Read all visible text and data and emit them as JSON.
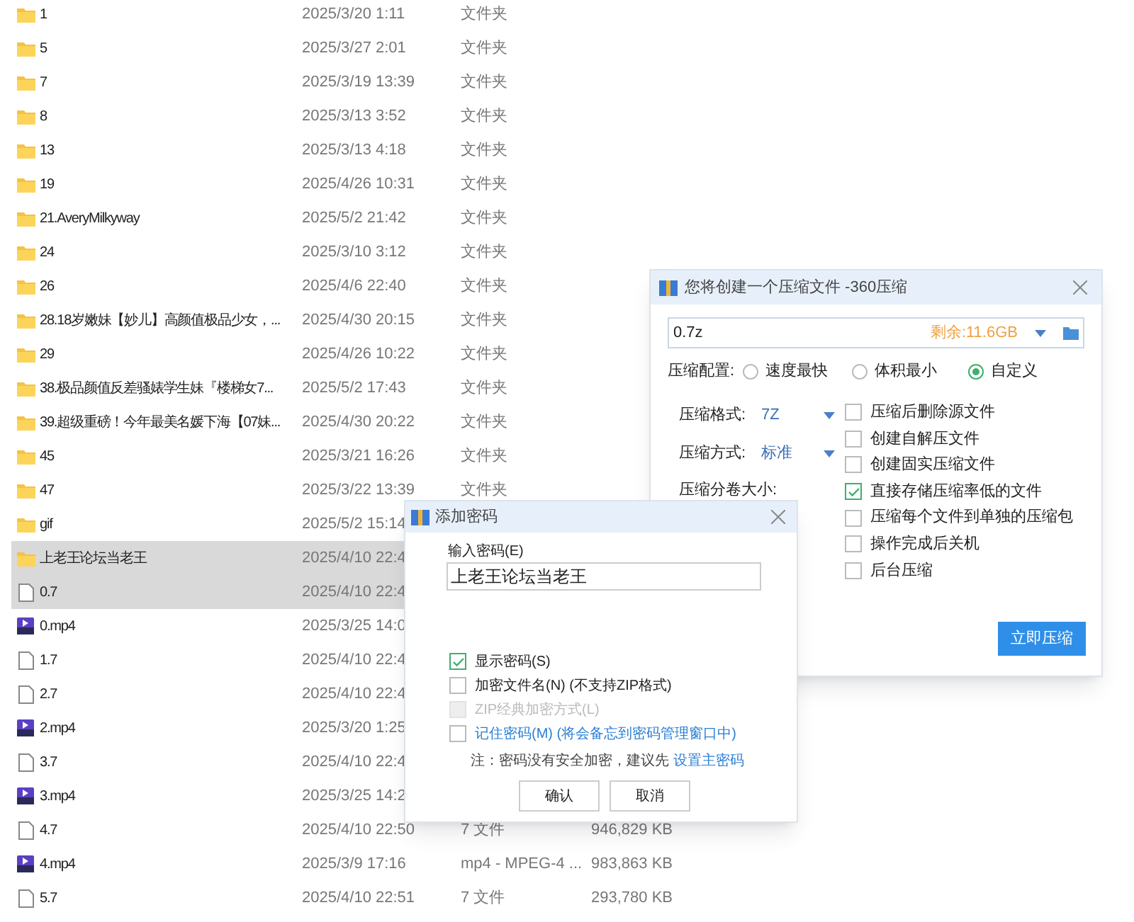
{
  "files": [
    {
      "kind": "folder",
      "name": "1",
      "date": "2025/3/20 1:11",
      "type": "文件夹",
      "selected": false
    },
    {
      "kind": "folder",
      "name": "5",
      "date": "2025/3/27 2:01",
      "type": "文件夹",
      "selected": false
    },
    {
      "kind": "folder",
      "name": "7",
      "date": "2025/3/19 13:39",
      "type": "文件夹",
      "selected": false
    },
    {
      "kind": "folder",
      "name": "8",
      "date": "2025/3/13 3:52",
      "type": "文件夹",
      "selected": false
    },
    {
      "kind": "folder",
      "name": "13",
      "date": "2025/3/13 4:18",
      "type": "文件夹",
      "selected": false
    },
    {
      "kind": "folder",
      "name": "19",
      "date": "2025/4/26 10:31",
      "type": "文件夹",
      "selected": false
    },
    {
      "kind": "folder",
      "name": "21.AveryMilkyway",
      "date": "2025/5/2 21:42",
      "type": "文件夹",
      "selected": false
    },
    {
      "kind": "folder",
      "name": "24",
      "date": "2025/3/10 3:12",
      "type": "文件夹",
      "selected": false
    },
    {
      "kind": "folder",
      "name": "26",
      "date": "2025/4/6 22:40",
      "type": "文件夹",
      "selected": false
    },
    {
      "kind": "folder",
      "name": "28.18岁嫩妹【妙儿】高颜值极品少女，...",
      "date": "2025/4/30 20:15",
      "type": "文件夹",
      "selected": false
    },
    {
      "kind": "folder",
      "name": "29",
      "date": "2025/4/26 10:22",
      "type": "文件夹",
      "selected": false
    },
    {
      "kind": "folder",
      "name": "38.极品颜值反差骚婊学生妹『楼梯女7...",
      "date": "2025/5/2 17:43",
      "type": "文件夹",
      "selected": false
    },
    {
      "kind": "folder",
      "name": "39.超级重磅！今年最美名媛下海【07妹...",
      "date": "2025/4/30 20:22",
      "type": "文件夹",
      "selected": false
    },
    {
      "kind": "folder",
      "name": "45",
      "date": "2025/3/21 16:26",
      "type": "文件夹",
      "selected": false
    },
    {
      "kind": "folder",
      "name": "47",
      "date": "2025/3/22 13:39",
      "type": "文件夹",
      "selected": false
    },
    {
      "kind": "folder",
      "name": "gif",
      "date": "2025/5/2 15:14",
      "selected": false
    },
    {
      "kind": "folder",
      "name": "上老王论坛当老王",
      "date": "2025/4/10 22:4",
      "selected": true
    },
    {
      "kind": "file",
      "name": "0.7",
      "date": "2025/4/10 22:4",
      "selected": true
    },
    {
      "kind": "video",
      "name": "0.mp4",
      "date": "2025/3/25 14:0",
      "selected": false
    },
    {
      "kind": "file",
      "name": "1.7",
      "date": "2025/4/10 22:4",
      "selected": false
    },
    {
      "kind": "file",
      "name": "2.7",
      "date": "2025/4/10 22:4",
      "selected": false
    },
    {
      "kind": "video",
      "name": "2.mp4",
      "date": "2025/3/20 1:25",
      "selected": false
    },
    {
      "kind": "file",
      "name": "3.7",
      "date": "2025/4/10 22:4",
      "selected": false
    },
    {
      "kind": "video",
      "name": "3.mp4",
      "date": "2025/3/25 14:2",
      "selected": false
    },
    {
      "kind": "file",
      "name": "4.7",
      "date": "2025/4/10 22:50",
      "type": "7 文件",
      "size": "946,829 KB",
      "selected": false
    },
    {
      "kind": "video",
      "name": "4.mp4",
      "date": "2025/3/9 17:16",
      "type": "mp4 - MPEG-4 ...",
      "size": "983,863 KB",
      "selected": false
    },
    {
      "kind": "file",
      "name": "5.7",
      "date": "2025/4/10 22:51",
      "type": "7 文件",
      "size": "293,780 KB",
      "selected": false
    }
  ],
  "compress_dialog": {
    "title": "您将创建一个压缩文件 -360压缩",
    "path": "0.7z",
    "free_space": "剩余:11.6GB",
    "config_label": "压缩配置:",
    "presets": [
      {
        "label": "速度最快",
        "selected": false
      },
      {
        "label": "体积最小",
        "selected": false
      },
      {
        "label": "自定义",
        "selected": true
      }
    ],
    "settings": [
      {
        "label": "压缩格式:",
        "value": "7Z"
      },
      {
        "label": "压缩方式:",
        "value": "标准"
      }
    ],
    "split_label": "压缩分卷大小:",
    "options": [
      {
        "label": "压缩后删除源文件",
        "checked": false
      },
      {
        "label": "创建自解压文件",
        "checked": false
      },
      {
        "label": "创建固实压缩文件",
        "checked": false
      },
      {
        "label": "直接存储压缩率低的文件",
        "checked": true
      },
      {
        "label": "压缩每个文件到单独的压缩包",
        "checked": false
      },
      {
        "label": "操作完成后关机",
        "checked": false
      },
      {
        "label": "后台压缩",
        "checked": false
      }
    ],
    "start_button": "立即压缩"
  },
  "password_dialog": {
    "title": "添加密码",
    "input_label": "输入密码(E)",
    "password": "上老王论坛当老王",
    "options": [
      {
        "label": "显示密码(S)",
        "checked": true,
        "disabled": false,
        "link": false
      },
      {
        "label": "加密文件名(N) (不支持ZIP格式)",
        "checked": false,
        "disabled": false,
        "link": false
      },
      {
        "label": "ZIP经典加密方式(L)",
        "checked": false,
        "disabled": true,
        "link": false
      },
      {
        "label": "记住密码(M) (将会备忘到密码管理窗口中)",
        "checked": false,
        "disabled": false,
        "link": true
      }
    ],
    "note": "注：密码没有安全加密，建议先",
    "note_link": "设置主密码",
    "buttons": [
      "确认",
      "取消"
    ]
  }
}
